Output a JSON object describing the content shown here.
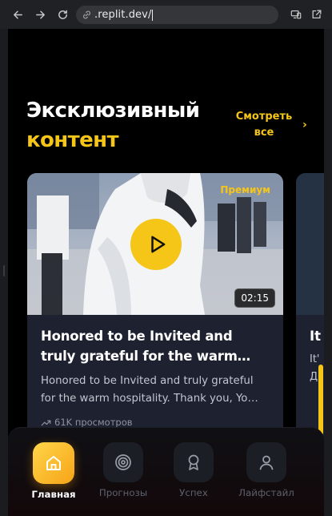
{
  "browser": {
    "url": ".replit.dev/"
  },
  "section": {
    "title_line1": "Эксклюзивный",
    "title_line2": "контент",
    "see_all": "Смотреть все",
    "see_all_chevron": "›"
  },
  "cards": [
    {
      "badge": "Премиум",
      "duration": "02:15",
      "title": "Honored to be Invited and truly grateful for the warm…",
      "description": "Honored to be Invited and truly grateful for the warm hospitality. Thank you, Yo…",
      "views": "61K просмотров"
    },
    {
      "title": "It",
      "description": "It'",
      "description_line2": "Д"
    }
  ],
  "tabs": [
    {
      "label": "Главная",
      "icon": "home-icon",
      "active": true
    },
    {
      "label": "Прогнозы",
      "icon": "target-icon",
      "active": false
    },
    {
      "label": "Успех",
      "icon": "award-icon",
      "active": false
    },
    {
      "label": "Лайфстайл",
      "icon": "user-icon",
      "active": false
    }
  ],
  "colors": {
    "accent": "#f5c518",
    "background": "#000000",
    "card": "#1d2130"
  }
}
